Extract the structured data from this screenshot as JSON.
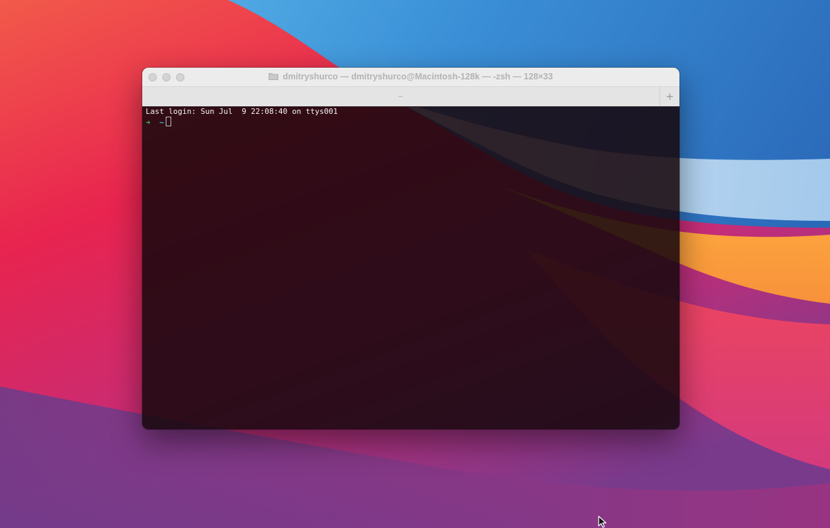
{
  "window": {
    "title": "dmitryshurco — dmitryshurco@Macintosh-128k — -zsh — 128×33",
    "tab_label": "~",
    "new_tab_glyph": "+"
  },
  "terminal": {
    "last_login": "Last login: Sun Jul  9 22:08:40 on ttys001",
    "prompt_arrow": "➜",
    "prompt_dir": "~"
  },
  "icons": {
    "folder": "folder-icon",
    "new_tab": "plus-icon",
    "pointer": "mouse-pointer-icon"
  },
  "colors": {
    "prompt_arrow": "#42c74a",
    "prompt_dir": "#44c3d8",
    "terminal_bg": "#18080e"
  }
}
